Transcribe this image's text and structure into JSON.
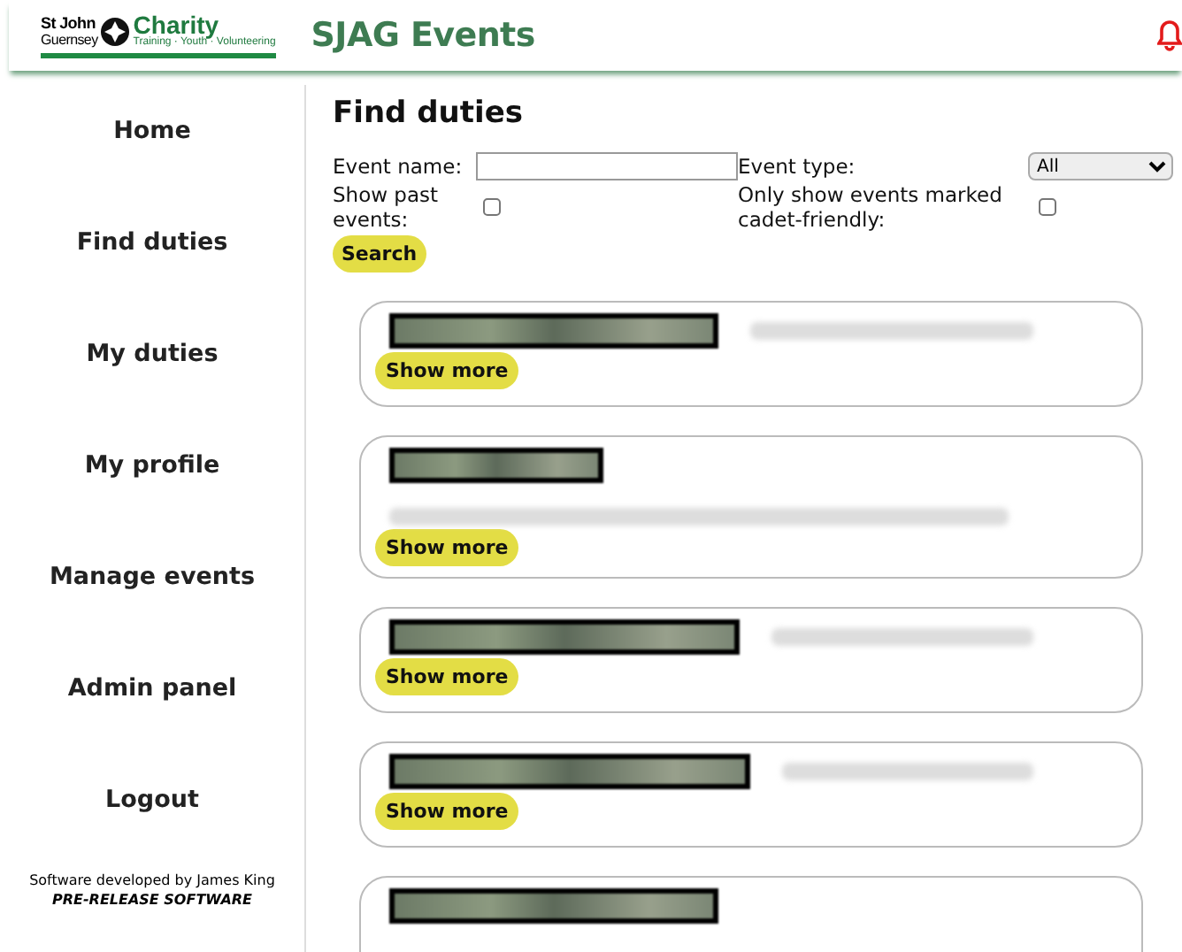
{
  "header": {
    "logo": {
      "line_1": "St John",
      "line_2": "Guernsey",
      "brand": "Charity",
      "tagline": "Training · Youth · Volunteering"
    },
    "title": "SJAG Events"
  },
  "sidebar": {
    "items": [
      {
        "label": "Home"
      },
      {
        "label": "Find duties"
      },
      {
        "label": "My duties"
      },
      {
        "label": "My profile"
      },
      {
        "label": "Manage events"
      },
      {
        "label": "Admin panel"
      },
      {
        "label": "Logout"
      }
    ],
    "footer": {
      "credit": "Software developed by James King",
      "notice": "PRE-RELEASE SOFTWARE"
    }
  },
  "main": {
    "heading": "Find duties",
    "filters": {
      "event_name": {
        "label": "Event name:"
      },
      "event_type": {
        "label": "Event type:",
        "value": "All"
      },
      "show_past": {
        "label": "Show past events:",
        "checked": false
      },
      "cadet_friendly": {
        "label": "Only show events marked cadet-friendly:",
        "checked": false
      },
      "search_button": "Search"
    },
    "events": [
      {
        "kind": "inline",
        "button": "Show more"
      },
      {
        "kind": "stacked",
        "button": "Show more"
      },
      {
        "kind": "inline",
        "button": "Show more"
      },
      {
        "kind": "inline",
        "button": "Show more"
      },
      {
        "kind": "cut"
      }
    ]
  }
}
